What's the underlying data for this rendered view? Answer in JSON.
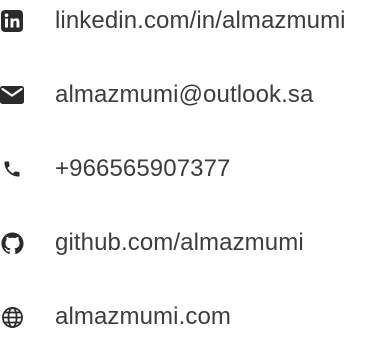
{
  "contacts": [
    {
      "icon": "linkedin-icon",
      "label": "linkedin.com/in/almazmumi"
    },
    {
      "icon": "envelope-icon",
      "label": "almazmumi@outlook.sa"
    },
    {
      "icon": "phone-icon",
      "label": "+966565907377"
    },
    {
      "icon": "github-icon",
      "label": "github.com/almazmumi"
    },
    {
      "icon": "globe-icon",
      "label": "almazmumi.com"
    }
  ],
  "colors": {
    "icon": "#2b2b2b",
    "text": "#3d3d3d",
    "background": "#ffffff"
  }
}
